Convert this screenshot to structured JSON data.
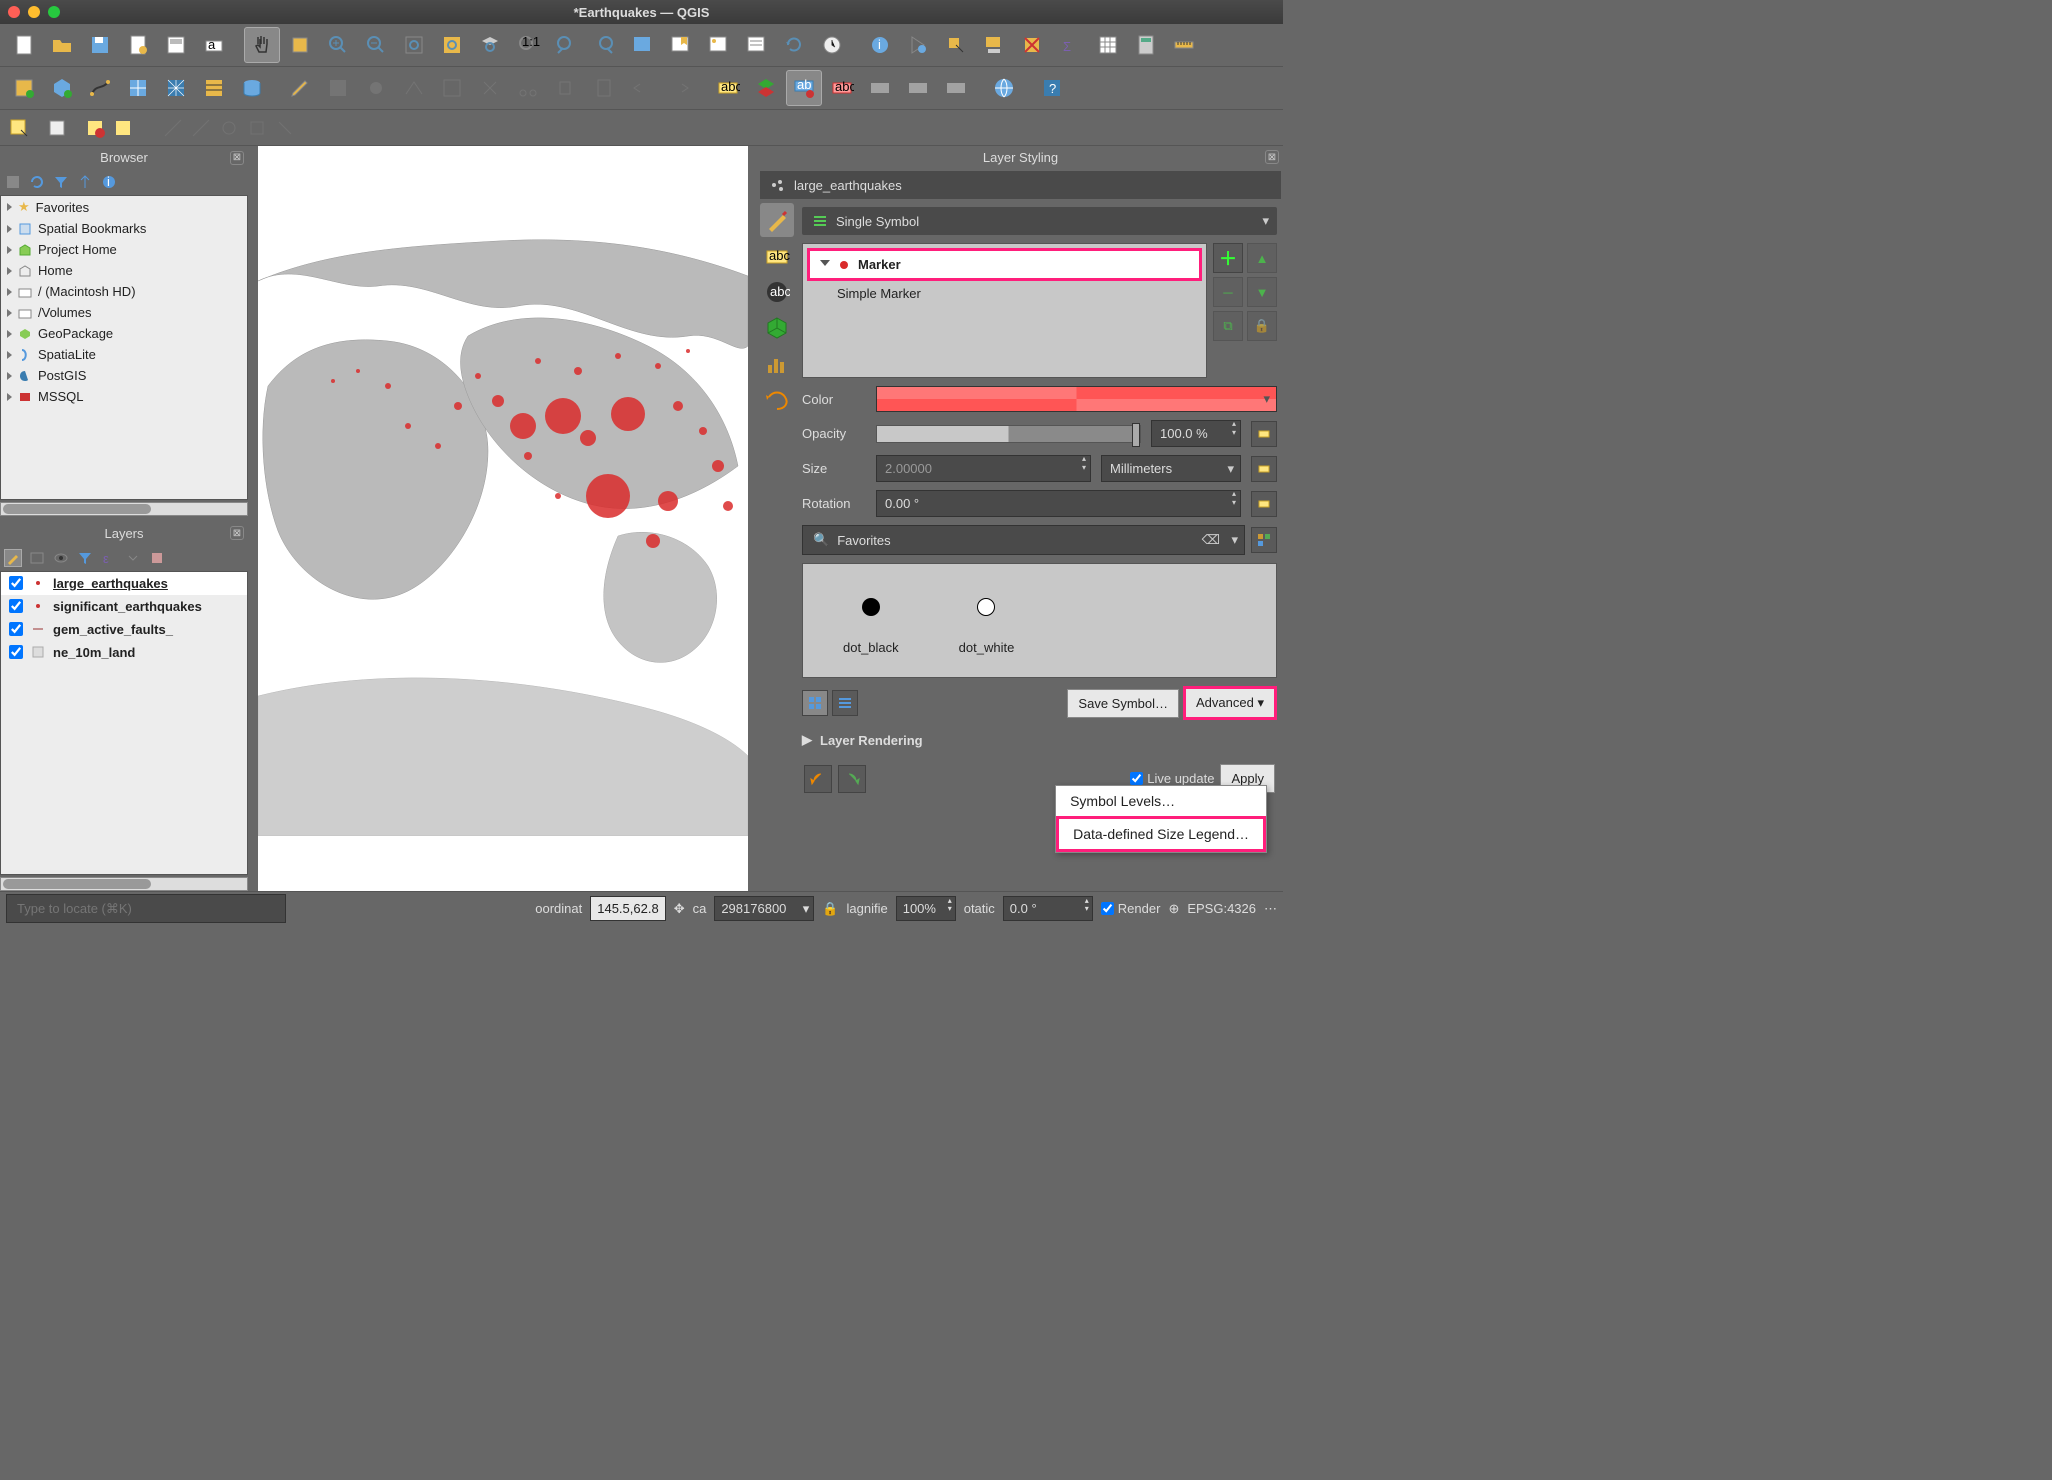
{
  "window": {
    "title": "*Earthquakes — QGIS"
  },
  "browser": {
    "title": "Browser",
    "items": [
      "Favorites",
      "Spatial Bookmarks",
      "Project Home",
      "Home",
      "/ (Macintosh HD)",
      "/Volumes",
      "GeoPackage",
      "SpatiaLite",
      "PostGIS",
      "MSSQL"
    ]
  },
  "layers": {
    "title": "Layers",
    "items": [
      {
        "name": "large_earthquakes",
        "checked": true,
        "active": true
      },
      {
        "name": "significant_earthquakes",
        "checked": true,
        "active": false
      },
      {
        "name": "gem_active_faults_",
        "checked": true,
        "active": false
      },
      {
        "name": "ne_10m_land",
        "checked": true,
        "active": false
      }
    ]
  },
  "layer_styling": {
    "title": "Layer Styling",
    "layer": "large_earthquakes",
    "renderer": "Single Symbol",
    "sym_tree": {
      "parent": "Marker",
      "child": "Simple Marker"
    },
    "props": {
      "color_label": "Color",
      "opacity_label": "Opacity",
      "opacity_value": "100.0 %",
      "size_label": "Size",
      "size_value": "2.00000",
      "size_unit": "Millimeters",
      "rotation_label": "Rotation",
      "rotation_value": "0.00 °"
    },
    "fav_search": "Favorites",
    "fav_items": [
      {
        "name": "dot_black"
      },
      {
        "name": "dot_white"
      }
    ],
    "save_symbol": "Save Symbol…",
    "advanced": "Advanced",
    "layer_rendering": "Layer Rendering",
    "live_update": "Live update",
    "apply": "Apply",
    "menu": {
      "symbol_levels": "Symbol Levels…",
      "dds_legend": "Data-defined Size Legend…"
    }
  },
  "status": {
    "locator_placeholder": "Type to locate (⌘K)",
    "coord_label": "oordinat",
    "coord_value": "145.5,62.8",
    "scale_label": "ca",
    "scale_value": "298176800",
    "mag_label": "lagnifie",
    "mag_value": "100%",
    "rot_label": "otatic",
    "rot_value": "0.0 °",
    "render": "Render",
    "crs": "EPSG:4326"
  }
}
